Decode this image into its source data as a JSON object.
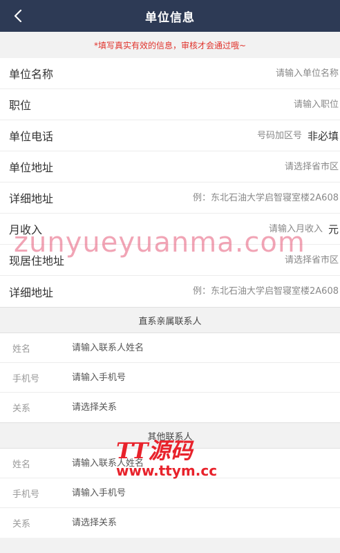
{
  "header": {
    "title": "单位信息",
    "back_icon": "chevron-left-icon"
  },
  "notice": "*填写真实有效的信息，审核才会通过哦~",
  "work_form": [
    {
      "label": "单位名称",
      "placeholder": "请输入单位名称",
      "suffix": ""
    },
    {
      "label": "职位",
      "placeholder": "请输入职位",
      "suffix": ""
    },
    {
      "label": "单位电话",
      "placeholder": "号码加区号",
      "suffix": "非必填"
    },
    {
      "label": "单位地址",
      "placeholder": "请选择省市区",
      "suffix": ""
    },
    {
      "label": "详细地址",
      "placeholder": "例：东北石油大学启智寝室楼2A608",
      "suffix": ""
    },
    {
      "label": "月收入",
      "placeholder": "请输入月收入",
      "suffix": "元"
    },
    {
      "label": "现居住地址",
      "placeholder": "请选择省市区",
      "suffix": ""
    },
    {
      "label": "详细地址",
      "placeholder": "例：东北石油大学启智寝室楼2A608",
      "suffix": ""
    }
  ],
  "direct_contact": {
    "title": "直系亲属联系人",
    "fields": [
      {
        "label": "姓名",
        "placeholder": "请输入联系人姓名"
      },
      {
        "label": "手机号",
        "placeholder": "请输入手机号"
      },
      {
        "label": "关系",
        "placeholder": "请选择关系"
      }
    ]
  },
  "other_contact": {
    "title": "其他联系人",
    "fields": [
      {
        "label": "姓名",
        "placeholder": "请输入联系人姓名"
      },
      {
        "label": "手机号",
        "placeholder": "请输入手机号"
      },
      {
        "label": "关系",
        "placeholder": "请选择关系"
      }
    ]
  },
  "watermarks": {
    "text": "zunyueyuanma.com",
    "logo": "TT源码",
    "logo_url": "www.ttym.cc"
  }
}
